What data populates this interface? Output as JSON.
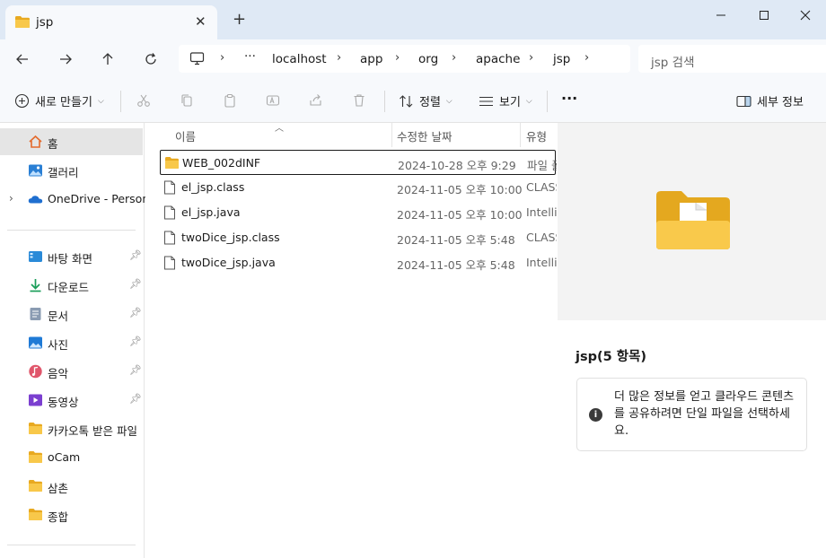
{
  "tab": {
    "title": "jsp",
    "icon": "folder-icon"
  },
  "titlebar": {
    "new_tab": "+",
    "close_tab": "✕"
  },
  "address": {
    "breadcrumb": [
      "localhost",
      "app",
      "org",
      "apache",
      "jsp"
    ],
    "more": "···"
  },
  "search": {
    "placeholder": "jsp 검색"
  },
  "toolbar": {
    "new_label": "새로 만들기",
    "sort_label": "정렬",
    "view_label": "보기",
    "more_label": "···",
    "details_label": "세부 정보"
  },
  "sidebar": {
    "home": "홈",
    "gallery": "갤러리",
    "onedrive": "OneDrive - Personal",
    "quick": [
      {
        "label": "바탕 화면",
        "icon": "desktop-icon",
        "pinned": true
      },
      {
        "label": "다운로드",
        "icon": "download-icon",
        "pinned": true
      },
      {
        "label": "문서",
        "icon": "documents-icon",
        "pinned": true
      },
      {
        "label": "사진",
        "icon": "pictures-icon",
        "pinned": true
      },
      {
        "label": "음악",
        "icon": "music-icon",
        "pinned": true
      },
      {
        "label": "동영상",
        "icon": "videos-icon",
        "pinned": true
      },
      {
        "label": "카카오톡 받은 파일",
        "icon": "folder-icon",
        "pinned": false
      },
      {
        "label": "oCam",
        "icon": "folder-icon",
        "pinned": false
      },
      {
        "label": "삼촌",
        "icon": "folder-icon",
        "pinned": false
      },
      {
        "label": "종합",
        "icon": "folder-icon",
        "pinned": false
      }
    ]
  },
  "columns": {
    "name": "이름",
    "modified": "수정한 날짜",
    "type": "유형"
  },
  "files": [
    {
      "name": "WEB_002dINF",
      "modified": "2024-10-28 오후 9:29",
      "type": "파일 폴더",
      "icon": "folder-icon"
    },
    {
      "name": "el_jsp.class",
      "modified": "2024-11-05 오후 10:00",
      "type": "CLASS",
      "icon": "file-icon"
    },
    {
      "name": "el_jsp.java",
      "modified": "2024-11-05 오후 10:00",
      "type": "IntelliJ",
      "icon": "file-icon"
    },
    {
      "name": "twoDice_jsp.class",
      "modified": "2024-11-05 오후 5:48",
      "type": "CLASS",
      "icon": "file-icon"
    },
    {
      "name": "twoDice_jsp.java",
      "modified": "2024-11-05 오후 5:48",
      "type": "IntelliJ",
      "icon": "file-icon"
    }
  ],
  "details": {
    "title": "jsp(5 항목)",
    "info": "더 많은 정보를 얻고 클라우드 콘텐츠를 공유하려면 단일 파일을 선택하세요.",
    "info_icon": "i"
  },
  "colors": {
    "accent": "#0067c0",
    "folder": "#f6c445",
    "titlebar": "#dfe9f5",
    "chrome": "#f7f9fc"
  }
}
